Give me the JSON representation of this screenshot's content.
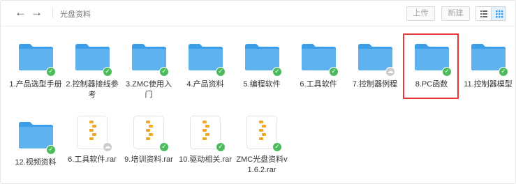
{
  "toolbar": {
    "back_icon": "←",
    "forward_icon": "→",
    "breadcrumb": "光盘资料",
    "upload_label": "上传",
    "new_label": "新建",
    "view_list_icon": "list-view-icon",
    "view_grid_icon": "grid-view-icon"
  },
  "colors": {
    "folder": "#3c9de8",
    "folder_tab": "#5fb2ef",
    "synced": "#4cbb5c",
    "cloud": "#cccccc",
    "highlight": "#e53935",
    "zip": "#f3a62c"
  },
  "items": [
    {
      "type": "folder",
      "label": "1.产品选型手册",
      "status": "synced"
    },
    {
      "type": "folder",
      "label": "2.控制器接线参考",
      "status": "synced"
    },
    {
      "type": "folder",
      "label": "3.ZMC使用入门",
      "status": "synced"
    },
    {
      "type": "folder",
      "label": "4.产品资料",
      "status": "synced"
    },
    {
      "type": "folder",
      "label": "5.编程软件",
      "status": "synced"
    },
    {
      "type": "folder",
      "label": "6.工具软件",
      "status": "synced"
    },
    {
      "type": "folder",
      "label": "7.控制器例程",
      "status": "cloud"
    },
    {
      "type": "folder",
      "label": "8.PC函数",
      "status": "synced",
      "highlighted": true
    },
    {
      "type": "folder",
      "label": "11.控制器模型",
      "status": "synced"
    },
    {
      "type": "folder",
      "label": "12.视频资料",
      "status": "synced"
    },
    {
      "type": "archive",
      "label": "6.工具软件.rar",
      "status": "cloud"
    },
    {
      "type": "archive",
      "label": "9.培训资料.rar",
      "status": "synced"
    },
    {
      "type": "archive",
      "label": "10.驱动相关.rar",
      "status": "synced"
    },
    {
      "type": "archive",
      "label": "ZMC光盘资料v1.6.2.rar",
      "status": "synced"
    }
  ]
}
